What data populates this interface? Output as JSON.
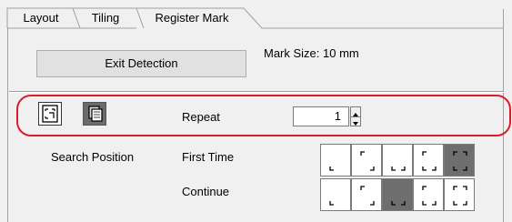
{
  "tabs": [
    {
      "label": "Layout",
      "active": false
    },
    {
      "label": "Tiling",
      "active": false
    },
    {
      "label": "Register Mark",
      "active": true
    }
  ],
  "exit_detection_label": "Exit Detection",
  "mark_size_text": "Mark Size:  10 mm",
  "repeat": {
    "label": "Repeat",
    "value": "1"
  },
  "search_position": {
    "label": "Search Position",
    "first_time_label": "First Time",
    "continue_label": "Continue",
    "first_time_selected_index": 4,
    "continue_selected_index": 2
  },
  "colors": {
    "highlight": "#d81e2a",
    "selected_cell": "#6e6e6e"
  },
  "icons": [
    "mark-pattern-icon",
    "page-stack-icon"
  ]
}
